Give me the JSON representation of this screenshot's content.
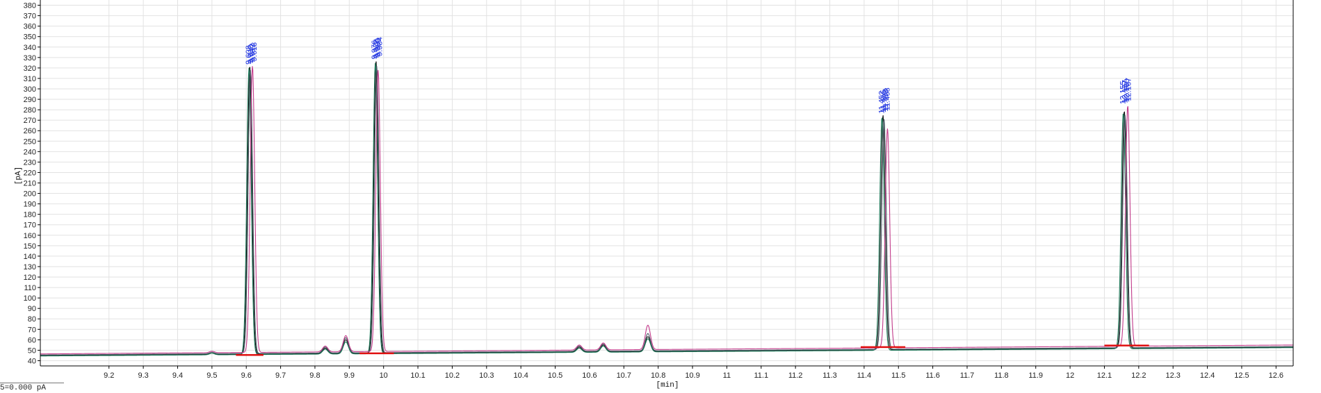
{
  "chart_data": {
    "type": "line",
    "title": "",
    "xlabel": "[min]",
    "ylabel": "[pA]",
    "xlim": [
      9.0,
      12.65
    ],
    "ylim": [
      35,
      385
    ],
    "x_ticks": [
      9.2,
      9.3,
      9.4,
      9.5,
      9.6,
      9.7,
      9.8,
      9.9,
      10,
      10.1,
      10.2,
      10.3,
      10.4,
      10.5,
      10.6,
      10.7,
      10.8,
      10.9,
      11,
      11.1,
      11.2,
      11.3,
      11.4,
      11.5,
      11.6,
      11.7,
      11.8,
      11.9,
      12,
      12.1,
      12.2,
      12.3,
      12.4,
      12.5,
      12.6
    ],
    "x_tick_labels": [
      "9.2",
      "9.3",
      "9.4",
      "9.5",
      "9.6",
      "9.7",
      "9.8",
      "9.9",
      "10",
      "10.1",
      "10.2",
      "10.3",
      "10.4",
      "10.5",
      "10.6",
      "10.7",
      "10.8",
      "10.9",
      "11",
      "11.1",
      "11.2",
      "11.3",
      "11.4",
      "11.5",
      "11.6",
      "11.7",
      "11.8",
      "11.9",
      "12",
      "12.1",
      "12.2",
      "12.3",
      "12.4",
      "12.5",
      "12.6"
    ],
    "y_ticks": [
      40,
      50,
      60,
      70,
      80,
      90,
      100,
      110,
      120,
      130,
      140,
      150,
      160,
      170,
      180,
      190,
      200,
      210,
      220,
      230,
      240,
      250,
      260,
      270,
      280,
      290,
      300,
      310,
      320,
      330,
      340,
      350,
      360,
      370,
      380
    ],
    "grid": true,
    "legend": "none",
    "series": [
      {
        "color": "#1a1a1a",
        "baseline": [
          [
            9.0,
            45.0
          ],
          [
            12.65,
            53.0
          ]
        ],
        "peaks": [
          {
            "rt": 9.61,
            "height": 322
          },
          {
            "rt": 9.978,
            "height": 327
          },
          {
            "rt": 11.455,
            "height": 275
          },
          {
            "rt": 12.158,
            "height": 279
          },
          {
            "rt": 9.5,
            "height": 48
          },
          {
            "rt": 9.83,
            "height": 52
          },
          {
            "rt": 9.89,
            "height": 60
          },
          {
            "rt": 10.57,
            "height": 53
          },
          {
            "rt": 10.64,
            "height": 55
          },
          {
            "rt": 10.77,
            "height": 63
          }
        ]
      },
      {
        "color": "#1e7a5a",
        "baseline": [
          [
            9.0,
            44.5
          ],
          [
            12.65,
            52.5
          ]
        ],
        "peaks": [
          {
            "rt": 9.608,
            "height": 320
          },
          {
            "rt": 9.976,
            "height": 325
          },
          {
            "rt": 11.452,
            "height": 273
          },
          {
            "rt": 12.155,
            "height": 277
          },
          {
            "rt": 9.5,
            "height": 47
          },
          {
            "rt": 9.83,
            "height": 51
          },
          {
            "rt": 9.89,
            "height": 58
          },
          {
            "rt": 10.57,
            "height": 52
          },
          {
            "rt": 10.64,
            "height": 54
          },
          {
            "rt": 10.77,
            "height": 61
          }
        ]
      },
      {
        "color": "#4a5a66",
        "baseline": [
          [
            9.0,
            45.5
          ],
          [
            12.65,
            53.5
          ]
        ],
        "peaks": [
          {
            "rt": 9.612,
            "height": 318
          },
          {
            "rt": 9.98,
            "height": 322
          },
          {
            "rt": 11.458,
            "height": 271
          },
          {
            "rt": 12.16,
            "height": 275
          },
          {
            "rt": 9.5,
            "height": 48
          },
          {
            "rt": 9.83,
            "height": 53
          },
          {
            "rt": 9.89,
            "height": 62
          },
          {
            "rt": 10.57,
            "height": 54
          },
          {
            "rt": 10.64,
            "height": 56
          },
          {
            "rt": 10.77,
            "height": 66
          }
        ]
      },
      {
        "color": "#c23a8a",
        "baseline": [
          [
            9.0,
            46.5
          ],
          [
            12.65,
            55.0
          ]
        ],
        "peaks": [
          {
            "rt": 9.618,
            "height": 322
          },
          {
            "rt": 9.984,
            "height": 318
          },
          {
            "rt": 11.468,
            "height": 262
          },
          {
            "rt": 12.168,
            "height": 284
          },
          {
            "rt": 9.5,
            "height": 49
          },
          {
            "rt": 9.83,
            "height": 54
          },
          {
            "rt": 9.89,
            "height": 64
          },
          {
            "rt": 10.57,
            "height": 55
          },
          {
            "rt": 10.64,
            "height": 57
          },
          {
            "rt": 10.77,
            "height": 74
          }
        ]
      }
    ],
    "integration_baselines": [
      {
        "x1": 9.57,
        "x2": 9.65,
        "y": 45.5
      },
      {
        "x1": 9.93,
        "x2": 10.03,
        "y": 47.0
      },
      {
        "x1": 11.39,
        "x2": 11.52,
        "y": 53.0
      },
      {
        "x1": 12.1,
        "x2": 12.23,
        "y": 54.5
      }
    ],
    "peak_annotations": [
      {
        "rt": 9.614,
        "labels": [
          "9.608",
          "9.610",
          "9.612",
          "9.618"
        ]
      },
      {
        "rt": 9.98,
        "labels": [
          "9.976",
          "9.978",
          "9.980",
          "9.984"
        ]
      },
      {
        "rt": 11.458,
        "labels": [
          "11.452",
          "11.455",
          "11.458",
          "11.468"
        ]
      },
      {
        "rt": 12.161,
        "labels": [
          "12.155",
          "12.157",
          "12.160",
          "12.167"
        ]
      }
    ],
    "colors": {
      "integration_baseline": "#e01010",
      "annotation": "#1a2fe0",
      "grid": "#e2e2e2",
      "axis": "#000000"
    }
  },
  "status": {
    "text": "5=0.000 pA"
  }
}
